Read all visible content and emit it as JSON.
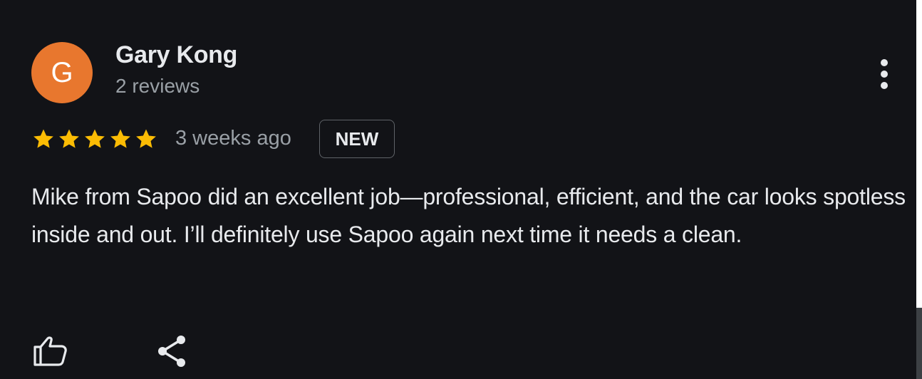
{
  "review": {
    "avatar_letter": "G",
    "avatar_color": "#e8772e",
    "author_name": "Gary Kong",
    "author_reviews": "2 reviews",
    "rating": 5,
    "rating_max": 5,
    "time_ago": "3 weeks ago",
    "badge": "NEW",
    "text": "Mike from Sapoo did an excellent job—professional, efficient, and the car looks spotless inside and out. I’ll definitely use Sapoo again next time it needs a clean."
  },
  "icons": {
    "menu": "more-vert-icon",
    "like": "thumb-up-icon",
    "share": "share-icon",
    "star": "star-icon"
  },
  "colors": {
    "background": "#121317",
    "star": "#fbbc04",
    "primary_text": "#e8eaed",
    "secondary_text": "#9aa0a6"
  }
}
